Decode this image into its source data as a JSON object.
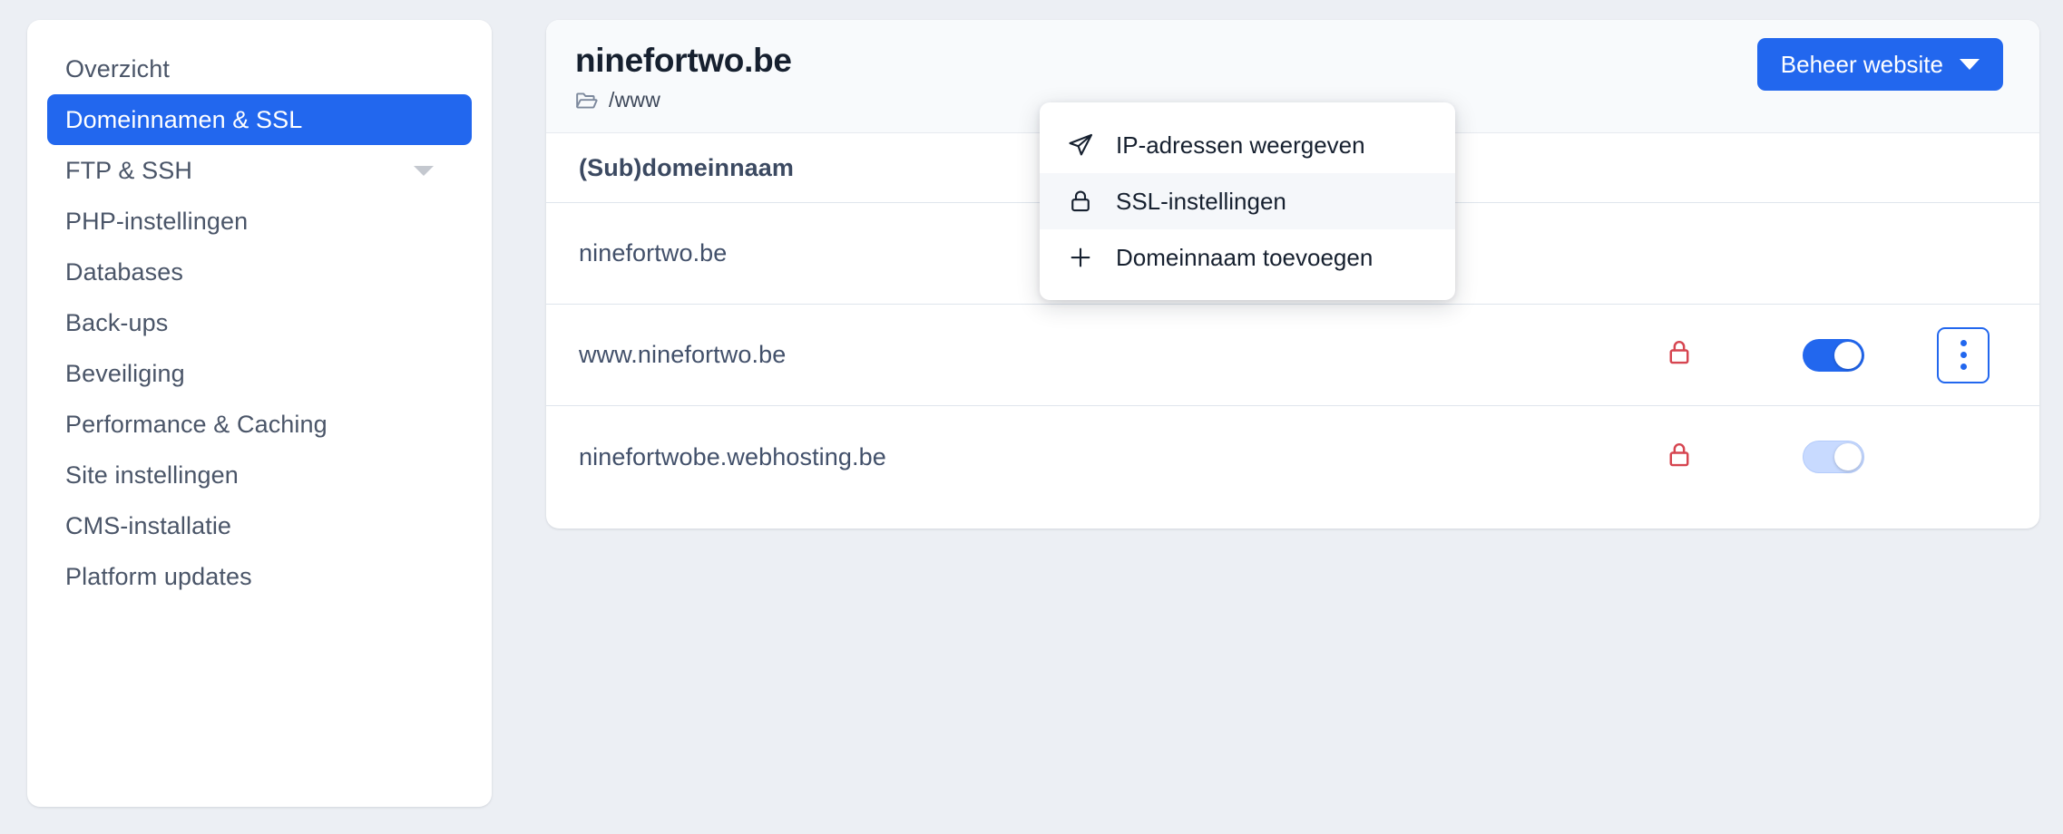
{
  "colors": {
    "accent": "#2267ee",
    "page_bg": "#eceff4",
    "card_bg": "#ffffff",
    "header_bg": "#f8fafc",
    "text": "#42506a",
    "title": "#16202f",
    "lock_red": "#d64550",
    "toggle_pending": "#c8daff",
    "border": "#dfe5ed"
  },
  "sidebar": {
    "items": [
      {
        "label": "Overzicht",
        "active": false,
        "has_chevron": false
      },
      {
        "label": "Domeinnamen & SSL",
        "active": true,
        "has_chevron": false
      },
      {
        "label": "FTP & SSH",
        "active": false,
        "has_chevron": true,
        "chevron_icon": "chevron-down-icon"
      },
      {
        "label": "PHP-instellingen",
        "active": false,
        "has_chevron": false
      },
      {
        "label": "Databases",
        "active": false,
        "has_chevron": false
      },
      {
        "label": "Back-ups",
        "active": false,
        "has_chevron": false
      },
      {
        "label": "Beveiliging",
        "active": false,
        "has_chevron": false
      },
      {
        "label": "Performance & Caching",
        "active": false,
        "has_chevron": false
      },
      {
        "label": "Site instellingen",
        "active": false,
        "has_chevron": false
      },
      {
        "label": "CMS-installatie",
        "active": false,
        "has_chevron": false
      },
      {
        "label": "Platform updates",
        "active": false,
        "has_chevron": false
      }
    ]
  },
  "header": {
    "title": "ninefortwo.be",
    "path": "/www",
    "folder_icon": "folder-open-icon",
    "manage_button": {
      "label": "Beheer website",
      "caret_icon": "caret-down-icon"
    }
  },
  "dropdown": {
    "open": true,
    "items": [
      {
        "label": "IP-adressen weergeven",
        "icon": "send-arrow-icon",
        "hover": false
      },
      {
        "label": "SSL-instellingen",
        "icon": "lock-icon",
        "hover": true
      },
      {
        "label": "Domeinnaam toevoegen",
        "icon": "plus-icon",
        "hover": false
      }
    ]
  },
  "table": {
    "columns": [
      "(Sub)domeinnaam"
    ],
    "rows": [
      {
        "name": "ninefortwo.be",
        "lock_icon": "lock-closed-icon",
        "lock_visible": false,
        "toggle_state": "hidden",
        "kebab_visible": false
      },
      {
        "name": "www.ninefortwo.be",
        "lock_icon": "lock-closed-icon",
        "lock_visible": true,
        "toggle_state": "on",
        "kebab_visible": true,
        "kebab_icon": "kebab-menu-icon"
      },
      {
        "name": "ninefortwobe.webhosting.be",
        "lock_icon": "lock-closed-icon",
        "lock_visible": true,
        "toggle_state": "pending",
        "kebab_visible": false
      }
    ]
  }
}
